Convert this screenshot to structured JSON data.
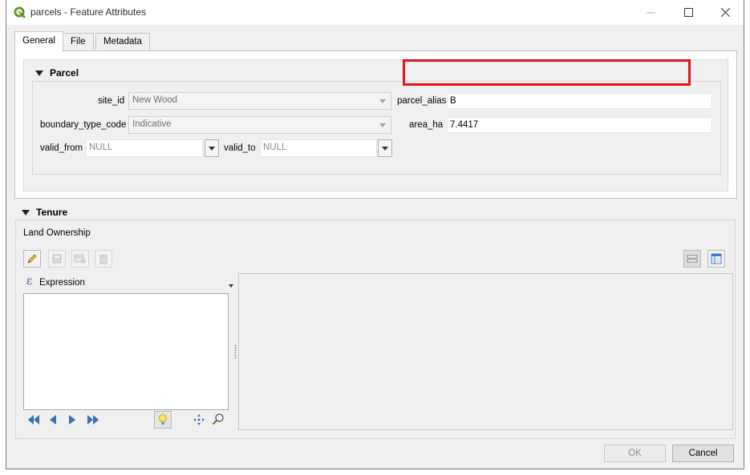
{
  "window": {
    "title": "parcels - Feature Attributes",
    "icon": "qgis-icon",
    "controls": [
      "minimize-icon",
      "maximize-icon",
      "close-icon"
    ]
  },
  "tabs": [
    {
      "label": "General",
      "active": true
    },
    {
      "label": "File",
      "active": false
    },
    {
      "label": "Metadata",
      "active": false
    }
  ],
  "parcel_group": {
    "title": "Parcel",
    "fields": {
      "site_id": {
        "label": "site_id",
        "value": "New Wood"
      },
      "parcel_alias": {
        "label": "parcel_alias",
        "value": "B"
      },
      "boundary_type_code": {
        "label": "boundary_type_code",
        "value": "Indicative"
      },
      "area_ha": {
        "label": "area_ha",
        "value": "7.4417"
      },
      "valid_from": {
        "label": "valid_from",
        "value": "NULL"
      },
      "valid_to": {
        "label": "valid_to",
        "value": "NULL"
      }
    },
    "highlight_color": "#e0141e"
  },
  "tenure_group": {
    "title": "Tenure",
    "relation_label": "Land Ownership",
    "toolbar": [
      "pencil-icon",
      "save-icon",
      "add-child-icon",
      "delete-icon"
    ],
    "view_toggles": [
      "form-view-icon",
      "table-view-icon"
    ],
    "expression_label": "Expression",
    "nav": [
      "first-icon",
      "previous-icon",
      "next-icon",
      "last-icon",
      "highlight-bulb-icon",
      "pan-icon",
      "zoom-icon"
    ]
  },
  "buttons": {
    "ok": "OK",
    "cancel": "Cancel"
  }
}
